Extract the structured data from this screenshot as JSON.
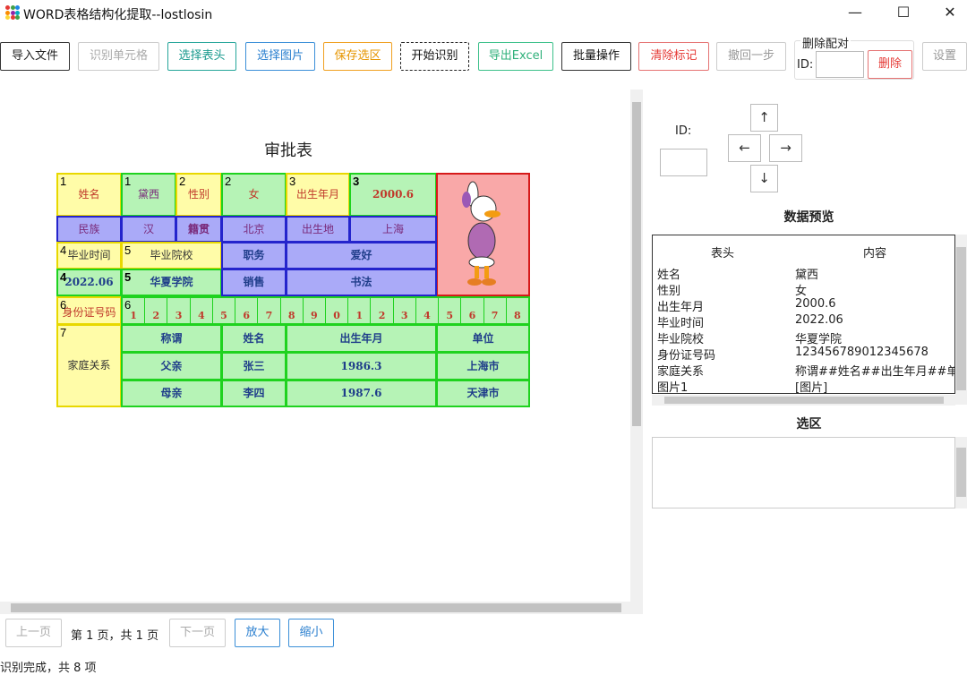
{
  "window": {
    "title": "WORD表格结构化提取--lostlosin",
    "minimize": "—",
    "maximize": "☐",
    "close": "✕"
  },
  "toolbar": {
    "import": "导入文件",
    "recognize_cells": "识别单元格",
    "select_header": "选择表头",
    "select_image": "选择图片",
    "save_selection": "保存选区",
    "start_recognize": "开始识别",
    "export_excel": "导出Excel",
    "batch": "批量操作",
    "clear_marks": "清除标记",
    "undo": "撤回一步",
    "settings": "设置"
  },
  "delete_pair": {
    "title": "删除配对",
    "id_label": "ID:",
    "id_value": "",
    "delete": "删除"
  },
  "document": {
    "title": "审批表",
    "cells": {
      "name_label": "姓名",
      "name_value": "黛西",
      "gender_label": "性别",
      "gender_value": "女",
      "birth_label": "出生年月",
      "birth_value": "2000.6",
      "ethnic_label": "民族",
      "ethnic_value": "汉",
      "native_label": "籍贯",
      "native_value": "北京",
      "birthplace_label": "出生地",
      "birthplace_value": "上海",
      "grad_time_label": "毕业时间",
      "grad_school_label": "毕业院校",
      "position_label": "职务",
      "position_value": "爱好",
      "grad_time_value": "2022.06",
      "grad_school_value": "华夏学院",
      "sales_label": "销售",
      "calligraphy_label": "书法",
      "id_label": "身份证号码",
      "id_digits": [
        "1",
        "2",
        "3",
        "4",
        "5",
        "6",
        "7",
        "8",
        "9",
        "0",
        "1",
        "2",
        "3",
        "4",
        "5",
        "6",
        "7",
        "8"
      ],
      "family_label": "家庭关系",
      "family_headers": [
        "称谓",
        "姓名",
        "出生年月",
        "单位"
      ],
      "family_rows": [
        [
          "父亲",
          "张三",
          "1986.3",
          "上海市"
        ],
        [
          "母亲",
          "李四",
          "1987.6",
          "天津市"
        ]
      ]
    },
    "ids": {
      "n1a": "1",
      "n1b": "1",
      "n2a": "2",
      "n2b": "2",
      "n3a": "3",
      "n3b": "3",
      "n4a": "4",
      "n4b": "4",
      "n5a": "5",
      "n5b": "5",
      "n6a": "6",
      "n6b": "6",
      "n7a": "7",
      "n7b": "7"
    }
  },
  "right_panel": {
    "id_label": "ID:",
    "id_value": "",
    "arrows": {
      "up": "↑",
      "left": "←",
      "right": "→",
      "down": "↓"
    },
    "preview_heading": "数据预览",
    "preview_columns": [
      "表头",
      "内容"
    ],
    "preview_rows": [
      [
        "姓名",
        "黛西"
      ],
      [
        "性别",
        "女"
      ],
      [
        "出生年月",
        "2000.6"
      ],
      [
        "毕业时间",
        "2022.06"
      ],
      [
        "毕业院校",
        "华夏学院"
      ],
      [
        "身份证号码",
        "123456789012345678"
      ],
      [
        "家庭关系",
        "称谓##姓名##出生年月##单"
      ],
      [
        "图片1",
        "[图片]"
      ]
    ],
    "selection_heading": "选区"
  },
  "pager": {
    "prev": "上一页",
    "info": "第 1 页，共 1 页",
    "next": "下一页",
    "zoom_in": "放大",
    "zoom_out": "缩小"
  },
  "status": "识别完成，共 8 项"
}
